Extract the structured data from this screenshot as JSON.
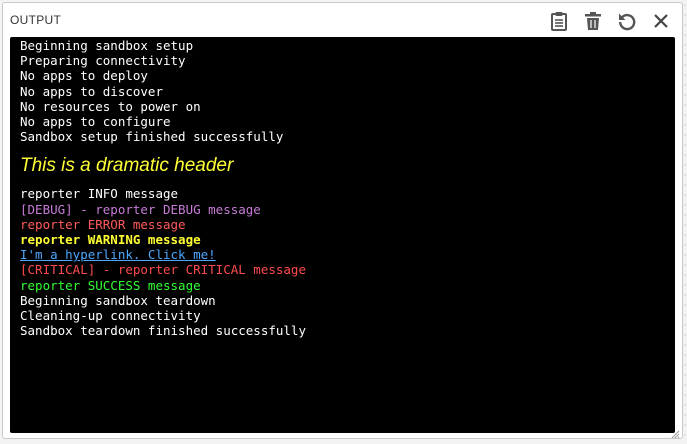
{
  "panel": {
    "title": "OUTPUT",
    "toolbar": [
      {
        "name": "clipboard-icon",
        "label": "Copy"
      },
      {
        "name": "trash-icon",
        "label": "Clear"
      },
      {
        "name": "refresh-icon",
        "label": "Reload"
      },
      {
        "name": "close-icon",
        "label": "Close"
      }
    ]
  },
  "console": {
    "setup_lines": [
      "Beginning sandbox setup",
      "Preparing connectivity",
      "No apps to deploy",
      "No apps to discover",
      "No resources to power on",
      "No apps to configure",
      "Sandbox setup finished successfully"
    ],
    "dramatic_header": "This is a dramatic header",
    "messages": {
      "info": "reporter INFO message",
      "debug": "[DEBUG] - reporter DEBUG message",
      "error": "reporter ERROR message",
      "warning": "reporter WARNING message",
      "hyperlink": "I'm a hyperlink. Click me!",
      "critical": "[CRITICAL] - reporter CRITICAL message",
      "success": "reporter SUCCESS message"
    },
    "teardown_lines": [
      "Beginning sandbox teardown",
      "Cleaning-up connectivity",
      "Sandbox teardown finished successfully"
    ]
  },
  "colors": {
    "console_bg": "#000000",
    "header_yellow": "#ffff33",
    "debug": "#c77bd6",
    "error": "#ff5b5b",
    "link": "#4ca8ff",
    "success": "#33ff33"
  }
}
